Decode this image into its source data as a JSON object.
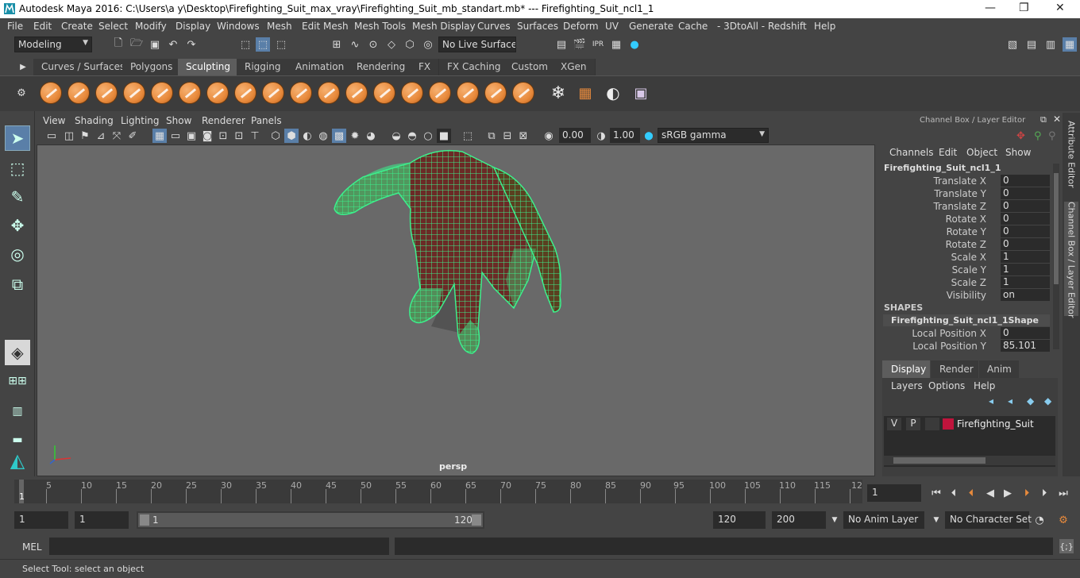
{
  "window": {
    "title": "Autodesk Maya 2016: C:\\Users\\a y\\Desktop\\Firefighting_Suit_max_vray\\Firefighting_Suit_mb_standart.mb*   ---   Firefighting_Suit_ncl1_1",
    "minimize": "—",
    "maximize": "❐",
    "close": "✕"
  },
  "menu": [
    "File",
    "Edit",
    "Create",
    "Select",
    "Modify",
    "Display",
    "Windows",
    "Mesh",
    "Edit Mesh",
    "Mesh Tools",
    "Mesh Display",
    "Curves",
    "Surfaces",
    "Deform",
    "UV",
    "Generate",
    "Cache",
    "- 3DtoAll -",
    "Redshift",
    "Help"
  ],
  "status": {
    "mode": "Modeling",
    "live_surface": "No Live Surface"
  },
  "shelf_tabs": [
    "Curves / Surfaces",
    "Polygons",
    "Sculpting",
    "Rigging",
    "Animation",
    "Rendering",
    "FX",
    "FX Caching",
    "Custom",
    "XGen"
  ],
  "shelf_active": "Sculpting",
  "viewport_menu": [
    "View",
    "Shading",
    "Lighting",
    "Show",
    "Renderer",
    "Panels"
  ],
  "viewport_toolbar": {
    "exposure": "0.00",
    "gamma": "1.00",
    "color_space": "sRGB gamma"
  },
  "viewport": {
    "camera_label": "persp",
    "object_color": "#3cf08c"
  },
  "channel_box": {
    "panel_title": "Channel Box / Layer Editor",
    "menu": [
      "Channels",
      "Edit",
      "Object",
      "Show"
    ],
    "object_name": "Firefighting_Suit_ncl1_1",
    "channels": [
      {
        "label": "Translate X",
        "value": "0"
      },
      {
        "label": "Translate Y",
        "value": "0"
      },
      {
        "label": "Translate Z",
        "value": "0"
      },
      {
        "label": "Rotate X",
        "value": "0"
      },
      {
        "label": "Rotate Y",
        "value": "0"
      },
      {
        "label": "Rotate Z",
        "value": "0"
      },
      {
        "label": "Scale X",
        "value": "1"
      },
      {
        "label": "Scale Y",
        "value": "1"
      },
      {
        "label": "Scale Z",
        "value": "1"
      },
      {
        "label": "Visibility",
        "value": "on"
      }
    ],
    "shapes_header": "SHAPES",
    "shape_name": "Firefighting_Suit_ncl1_1Shape",
    "shape_channels": [
      {
        "label": "Local Position X",
        "value": "0"
      },
      {
        "label": "Local Position Y",
        "value": "85.101"
      }
    ]
  },
  "layer_editor": {
    "tabs": [
      "Display",
      "Render",
      "Anim"
    ],
    "active_tab": "Display",
    "menu": [
      "Layers",
      "Options",
      "Help"
    ],
    "layers": [
      {
        "v": "V",
        "p": "P",
        "name": "Firefighting_Suit",
        "color": "#c0143c"
      }
    ]
  },
  "side_tabs": [
    "Attribute Editor",
    "Channel Box / Layer Editor"
  ],
  "timeline": {
    "ticks": [
      "5",
      "10",
      "15",
      "20",
      "25",
      "30",
      "35",
      "40",
      "45",
      "50",
      "55",
      "60",
      "65",
      "70",
      "75",
      "80",
      "85",
      "90",
      "95",
      "100",
      "105",
      "110",
      "115",
      "12"
    ],
    "current_frame_marker": "1",
    "current_frame": "1"
  },
  "range": {
    "start": "1",
    "playback_start": "1",
    "slider_start": "1",
    "slider_end": "120",
    "playback_end": "120",
    "end": "200",
    "anim_layer": "No Anim Layer",
    "character_set": "No Character Set"
  },
  "command": {
    "label": "MEL"
  },
  "help_line": "Select Tool: select an object"
}
